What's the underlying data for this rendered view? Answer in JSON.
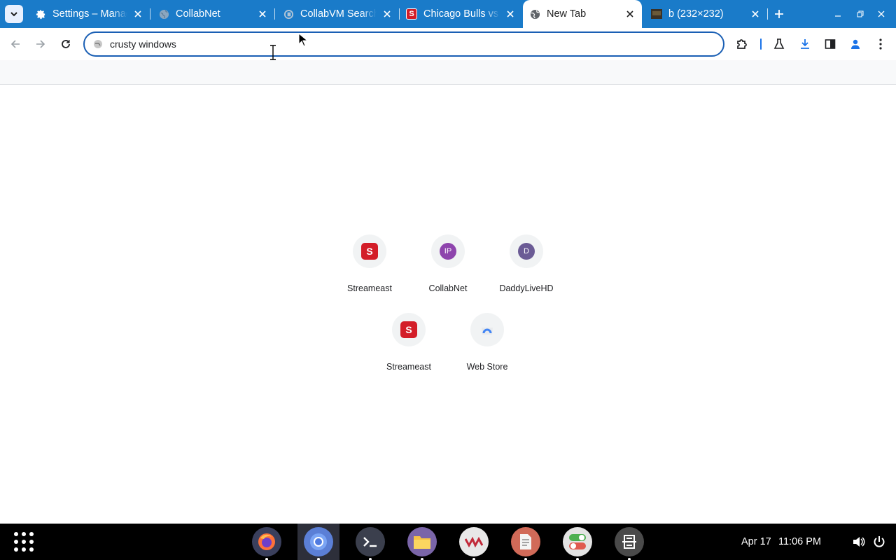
{
  "browser": {
    "tabs": [
      {
        "title": "Settings – Manage",
        "icon": "gear-icon",
        "active": false
      },
      {
        "title": "CollabNet",
        "icon": "globe-icon",
        "active": false
      },
      {
        "title": "CollabVM Search",
        "icon": "collabvm-icon",
        "active": false
      },
      {
        "title": "Chicago Bulls vs",
        "icon": "streameast-icon",
        "active": false
      },
      {
        "title": "New Tab",
        "icon": "globe-icon",
        "active": true
      },
      {
        "title": "b (232×232)",
        "icon": "image-icon",
        "active": false
      }
    ],
    "omnibox": {
      "value": "crusty windows",
      "placeholder": ""
    }
  },
  "ntp": {
    "shortcuts": [
      {
        "label": "Streameast",
        "icon": "S"
      },
      {
        "label": "CollabNet",
        "icon": "IP",
        "color": "#8e44ad"
      },
      {
        "label": "DaddyLiveHD",
        "icon": "D",
        "color": "#6b5b95"
      },
      {
        "label": "Streameast",
        "icon": "S"
      },
      {
        "label": "Web Store",
        "icon": "webstore-icon"
      }
    ]
  },
  "shelf": {
    "apps": [
      "firefox",
      "chromium",
      "terminal",
      "files",
      "collabvm",
      "text-editor",
      "settings-toggle",
      "ocr-tool"
    ],
    "date": "Apr 17",
    "time": "11:06 PM"
  },
  "colors": {
    "tabstrip": "#1a7bc9",
    "omnibox_border": "#1a5fb4",
    "streameast_red": "#d31d28"
  }
}
